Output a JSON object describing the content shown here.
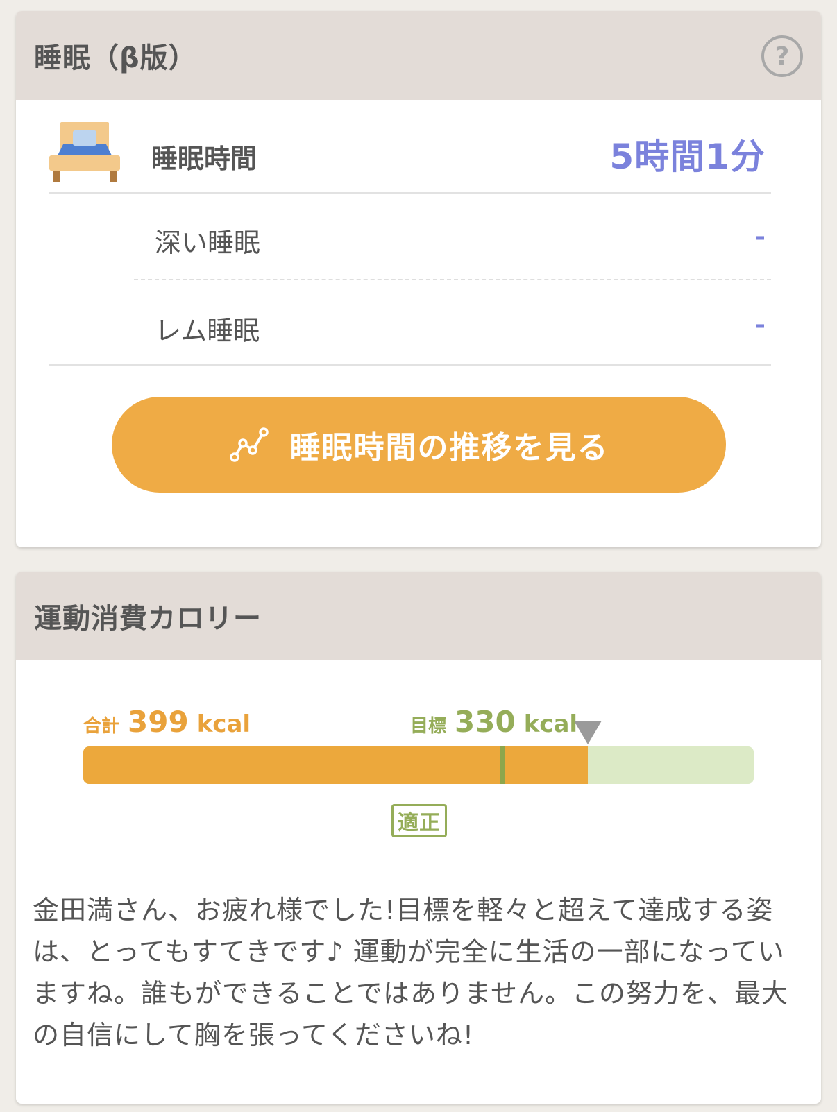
{
  "sleep": {
    "title": "睡眠（β版）",
    "help_icon": "question-circle-icon",
    "bed_icon": "bed-icon",
    "total_label": "睡眠時間",
    "total_value": "5時間1分",
    "deep_label": "深い睡眠",
    "deep_value": "-",
    "rem_label": "レム睡眠",
    "rem_value": "-",
    "trend_button_label": "睡眠時間の推移を見る",
    "trend_icon": "line-chart-icon",
    "accent_color": "#7b82dc",
    "button_color": "#efab45"
  },
  "calories": {
    "title": "運動消費カロリー",
    "total_label": "合計",
    "total_value": "399",
    "goal_label": "目標",
    "goal_value": "330",
    "unit": "kcal",
    "total_fraction_of_bar": 0.753,
    "midline_fraction_of_bar": 0.625,
    "status_badge": "適正",
    "message": "金田満さん、お疲れ様でした!目標を軽々と超えて達成する姿は、とってもすてきです♪ 運動が完全に生活の一部になっていますね。誰もができることではありません。この努力を、最大の自信にして胸を張ってくださいね!",
    "fill_color": "#eca83c",
    "track_color": "#dceac6",
    "ok_color": "#95ad59"
  }
}
